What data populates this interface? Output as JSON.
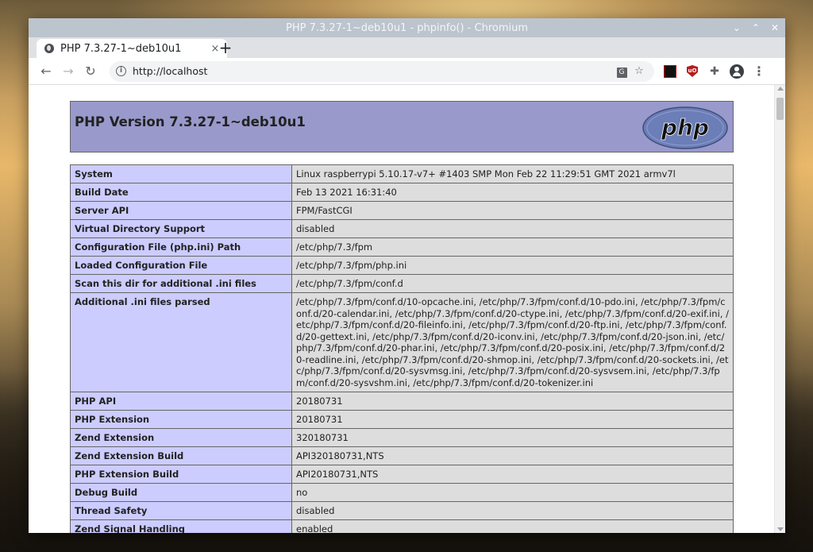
{
  "window": {
    "title": "PHP 7.3.27-1~deb10u1 - phpinfo() - Chromium",
    "controls": [
      "⌄",
      "⌃",
      "✕"
    ]
  },
  "tab": {
    "label": "PHP 7.3.27-1~deb10u1",
    "close": "×",
    "new_tab": "+"
  },
  "toolbar": {
    "back": "←",
    "forward": "→",
    "reload": "↻",
    "url": "http://localhost",
    "bookmark": "☆",
    "menu": "⋮"
  },
  "php": {
    "heading": "PHP Version 7.3.27-1~deb10u1",
    "logo_text": "php"
  },
  "rows": [
    {
      "key": "System",
      "value": "Linux raspberrypi 5.10.17-v7+ #1403 SMP Mon Feb 22 11:29:51 GMT 2021 armv7l"
    },
    {
      "key": "Build Date",
      "value": "Feb 13 2021 16:31:40"
    },
    {
      "key": "Server API",
      "value": "FPM/FastCGI"
    },
    {
      "key": "Virtual Directory Support",
      "value": "disabled"
    },
    {
      "key": "Configuration File (php.ini) Path",
      "value": "/etc/php/7.3/fpm"
    },
    {
      "key": "Loaded Configuration File",
      "value": "/etc/php/7.3/fpm/php.ini"
    },
    {
      "key": "Scan this dir for additional .ini files",
      "value": "/etc/php/7.3/fpm/conf.d"
    },
    {
      "key": "Additional .ini files parsed",
      "value": "/etc/php/7.3/fpm/conf.d/10-opcache.ini, /etc/php/7.3/fpm/conf.d/10-pdo.ini, /etc/php/7.3/fpm/conf.d/20-calendar.ini, /etc/php/7.3/fpm/conf.d/20-ctype.ini, /etc/php/7.3/fpm/conf.d/20-exif.ini, /etc/php/7.3/fpm/conf.d/20-fileinfo.ini, /etc/php/7.3/fpm/conf.d/20-ftp.ini, /etc/php/7.3/fpm/conf.d/20-gettext.ini, /etc/php/7.3/fpm/conf.d/20-iconv.ini, /etc/php/7.3/fpm/conf.d/20-json.ini, /etc/php/7.3/fpm/conf.d/20-phar.ini, /etc/php/7.3/fpm/conf.d/20-posix.ini, /etc/php/7.3/fpm/conf.d/20-readline.ini, /etc/php/7.3/fpm/conf.d/20-shmop.ini, /etc/php/7.3/fpm/conf.d/20-sockets.ini, /etc/php/7.3/fpm/conf.d/20-sysvmsg.ini, /etc/php/7.3/fpm/conf.d/20-sysvsem.ini, /etc/php/7.3/fpm/conf.d/20-sysvshm.ini, /etc/php/7.3/fpm/conf.d/20-tokenizer.ini"
    },
    {
      "key": "PHP API",
      "value": "20180731"
    },
    {
      "key": "PHP Extension",
      "value": "20180731"
    },
    {
      "key": "Zend Extension",
      "value": "320180731"
    },
    {
      "key": "Zend Extension Build",
      "value": "API320180731,NTS"
    },
    {
      "key": "PHP Extension Build",
      "value": "API20180731,NTS"
    },
    {
      "key": "Debug Build",
      "value": "no"
    },
    {
      "key": "Thread Safety",
      "value": "disabled"
    },
    {
      "key": "Zend Signal Handling",
      "value": "enabled"
    }
  ]
}
